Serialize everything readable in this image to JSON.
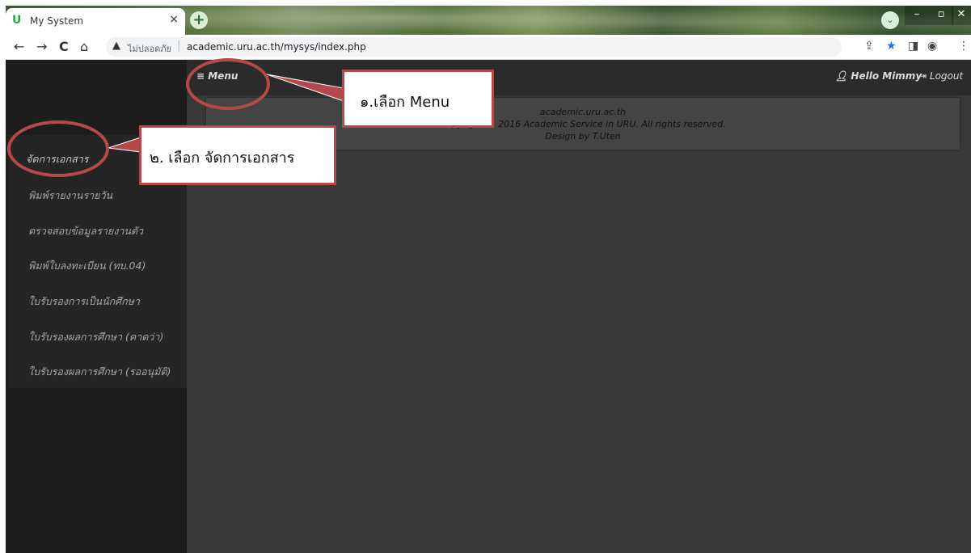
{
  "browser": {
    "tab_title": "My System",
    "tab_favicon": "U",
    "tab_close": "×",
    "new_tab": "+",
    "security_label": "ไม่ปลอดภัย",
    "url": "academic.uru.ac.th/mysys/index.php"
  },
  "topbar": {
    "menu_label": "≡ Menu",
    "hello": "Hello Mimmy",
    "logout": "Logout"
  },
  "sidebar": {
    "items": [
      {
        "label": "จัดการเอกสาร"
      },
      {
        "label": "พิมพ์รายงานรายวัน"
      },
      {
        "label": "ตรวจสอบข้อมูลรายงานตัว"
      },
      {
        "label": "พิมพ์ใบลงทะเบียน (ทบ.04)"
      },
      {
        "label": "ใบรับรองการเป็นนักศึกษา"
      },
      {
        "label": "ใบรับรองผลการศึกษา (คาดว่า)"
      },
      {
        "label": "ใบรับรองผลการศึกษา (รออนุมัติ)"
      }
    ]
  },
  "footer": {
    "line1": "academic.uru.ac.th",
    "line2": "Copyright © 2016 Academic Service in URU. All rights reserved.",
    "line3": "Design by T.Uten"
  },
  "annotations": {
    "step1": "๑.เลือก  Menu",
    "step2": "๒. เลือก จัดการเอกสาร",
    "color": "#b5484a"
  }
}
